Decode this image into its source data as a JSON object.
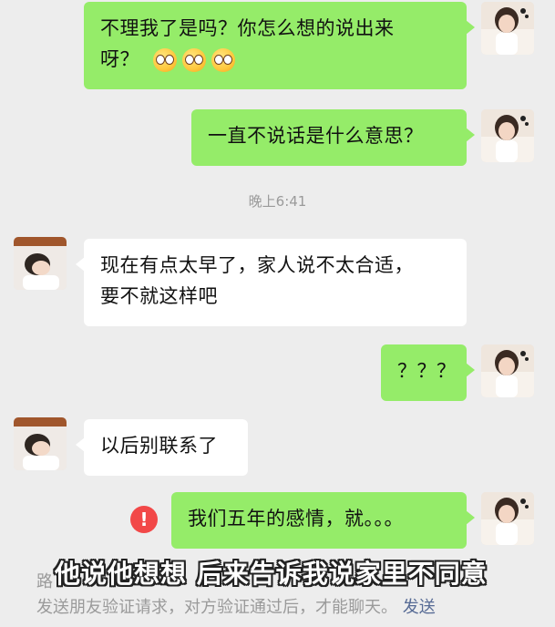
{
  "messages": [
    {
      "side": "me",
      "text": "不理我了是吗？你怎么想的说出来",
      "text2": "呀？",
      "emojis": [
        "flushed-face-icon",
        "flushed-face-icon",
        "flushed-face-icon"
      ]
    },
    {
      "side": "me",
      "text": "一直不说话是什么意思？"
    },
    {
      "side": "other",
      "text": "现在有点太早了，家人说不太合适，",
      "text2": "要不就这样吧"
    },
    {
      "side": "me",
      "text": "？？？"
    },
    {
      "side": "other",
      "text": "以后别联系了"
    },
    {
      "side": "me",
      "text": "我们五年的感情，就。。。",
      "failed": true
    }
  ],
  "timestamp": "晚上6:41",
  "error_icon": "!",
  "system_notice": {
    "top_partial": "路",
    "text": "发送朋友验证请求，对方验证通过后，才能聊天。",
    "link": "发送"
  },
  "subtitle": "他说他想想 后来告诉我说家里不同意",
  "colors": {
    "background": "#ededed",
    "my_bubble": "#95ec69",
    "other_bubble": "#ffffff",
    "error": "#f24848",
    "link": "#576b95"
  }
}
